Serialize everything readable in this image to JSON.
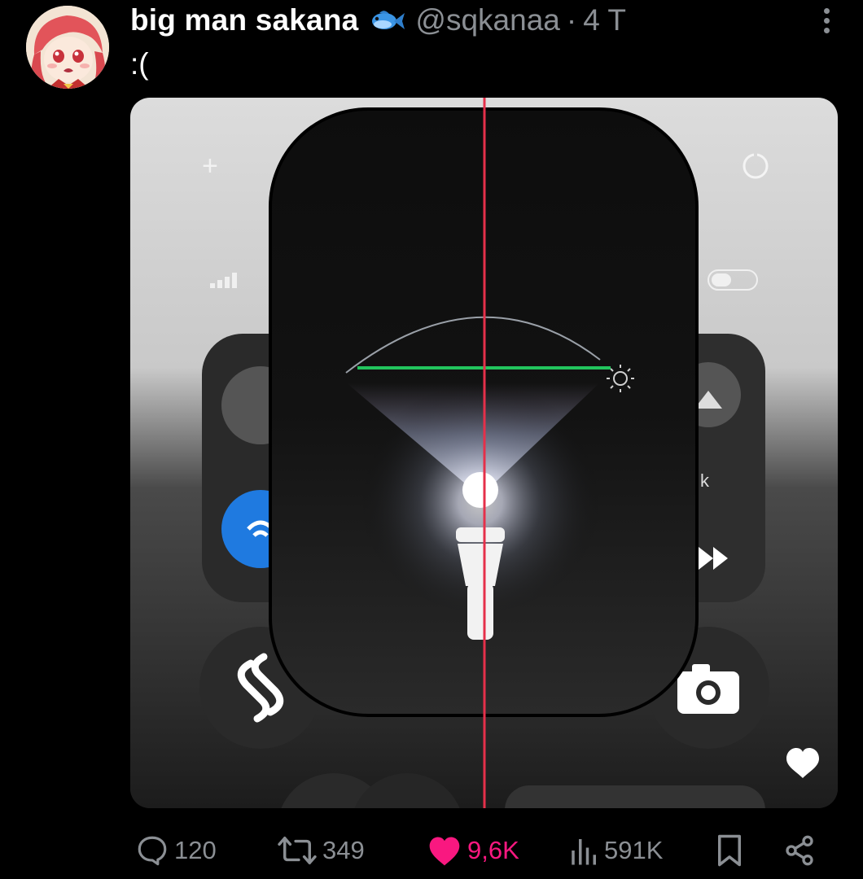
{
  "tweet": {
    "author_name": "big man sakana",
    "handle": "@sqkanaa",
    "separator": "·",
    "time": "4 T",
    "text": ":("
  },
  "actions": {
    "replies": "120",
    "retweets": "349",
    "likes": "9,6K",
    "views": "591K"
  },
  "colors": {
    "like_active": "#f91880",
    "secondary_text": "#8b8f94",
    "background": "#000000",
    "red_guide_line": "#e5304a",
    "green_guide_line": "#22c55e"
  },
  "icons": [
    "fish-emoji-icon",
    "more-options-icon",
    "reply-icon",
    "retweet-icon",
    "like-icon",
    "views-icon",
    "bookmark-icon",
    "share-icon"
  ]
}
